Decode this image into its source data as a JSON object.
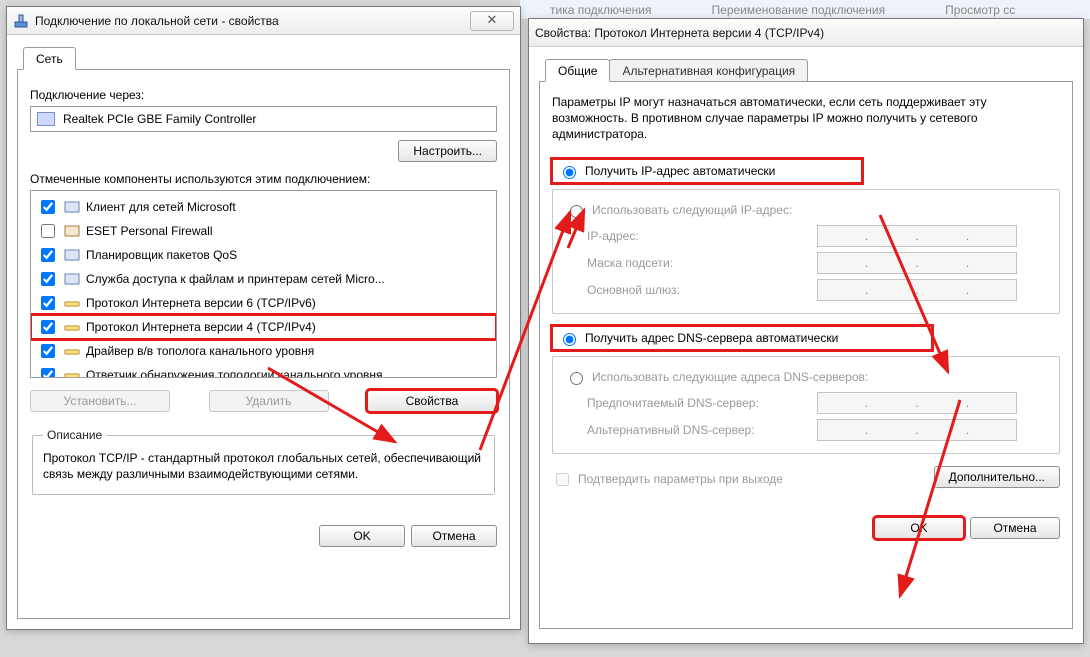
{
  "leftDialog": {
    "title": "Подключение по локальной сети - свойства",
    "tab": "Сеть",
    "connectThroughLabel": "Подключение через:",
    "adapter": "Realtek PCIe GBE Family Controller",
    "configureBtn": "Настроить...",
    "componentsLabel": "Отмеченные компоненты используются этим подключением:",
    "items": [
      {
        "checked": true,
        "label": "Клиент для сетей Microsoft"
      },
      {
        "checked": false,
        "label": "ESET Personal Firewall"
      },
      {
        "checked": true,
        "label": "Планировщик пакетов QoS"
      },
      {
        "checked": true,
        "label": "Служба доступа к файлам и принтерам сетей Micro..."
      },
      {
        "checked": true,
        "label": "Протокол Интернета версии 6 (TCP/IPv6)"
      },
      {
        "checked": true,
        "label": "Протокол Интернета версии 4 (TCP/IPv4)",
        "selected": true
      },
      {
        "checked": true,
        "label": "Драйвер в/в тополога канального уровня"
      },
      {
        "checked": true,
        "label": "Ответчик обнаружения топологии канального уровня"
      }
    ],
    "installBtn": "Установить...",
    "removeBtn": "Удалить",
    "propertiesBtn": "Свойства",
    "descTitle": "Описание",
    "descText": "Протокол TCP/IP - стандартный протокол глобальных сетей, обеспечивающий связь между различными взаимодействующими сетями.",
    "okBtn": "OK",
    "cancelBtn": "Отмена"
  },
  "rightDialog": {
    "title": "Свойства: Протокол Интернета версии 4 (TCP/IPv4)",
    "tabs": [
      "Общие",
      "Альтернативная конфигурация"
    ],
    "intro": "Параметры IP могут назначаться автоматически, если сеть поддерживает эту возможность. В противном случае параметры IP можно получить у сетевого администратора.",
    "ipAuto": "Получить IP-адрес автоматически",
    "ipManual": "Использовать следующий IP-адрес:",
    "ipFields": {
      "ip": "IP-адрес:",
      "mask": "Маска подсети:",
      "gateway": "Основной шлюз:"
    },
    "dnsAuto": "Получить адрес DNS-сервера автоматически",
    "dnsManual": "Использовать следующие адреса DNS-серверов:",
    "dnsFields": {
      "preferred": "Предпочитаемый DNS-сервер:",
      "alt": "Альтернативный DNS-сервер:"
    },
    "confirmOnExit": "Подтвердить параметры при выходе",
    "advancedBtn": "Дополнительно...",
    "okBtn": "OK",
    "cancelBtn": "Отмена"
  },
  "background": {
    "strip1": "тика подключения",
    "strip2": "Переименование подключения",
    "strip3": "Просмотр сс"
  }
}
